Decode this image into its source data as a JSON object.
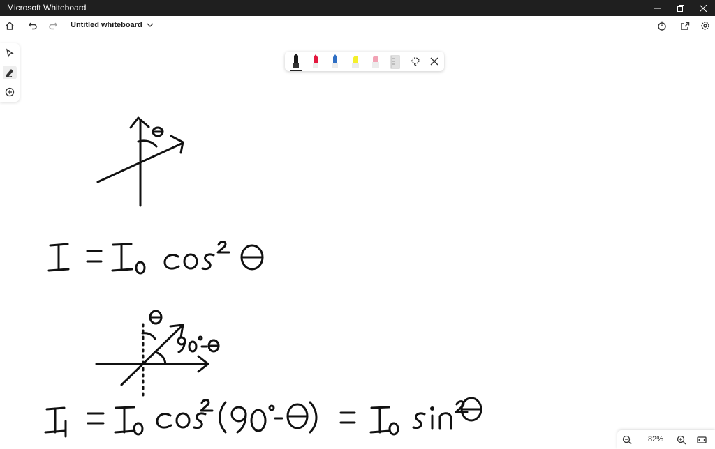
{
  "window": {
    "title": "Microsoft Whiteboard"
  },
  "toolbar": {
    "doc_title": "Untitled whiteboard",
    "icons": [
      "home-icon",
      "undo-icon",
      "redo-icon",
      "timer-icon",
      "share-icon",
      "settings-icon"
    ]
  },
  "left_rail": {
    "tools": [
      "select-icon",
      "pen-icon",
      "add-icon"
    ],
    "active_tool": "pen"
  },
  "pen_tray": {
    "pens": [
      {
        "name": "black-pen",
        "color": "#1a1a1a"
      },
      {
        "name": "red-pen",
        "color": "#e3173e"
      },
      {
        "name": "blue-pen",
        "color": "#2f6fc4"
      },
      {
        "name": "yellow-highlighter",
        "color": "#f4ef2b"
      },
      {
        "name": "pink-highlighter",
        "color": "#f2a3b5"
      },
      {
        "name": "ruler",
        "color": "#d0d0d0"
      }
    ],
    "selected": "black-pen",
    "extra_icons": [
      "lasso-icon",
      "close-icon"
    ]
  },
  "canvas": {
    "handwriting_equation_1": "I = I₀ cos² θ",
    "handwriting_equation_2": "I₁ = I₀ cos²(90°-θ) = I₀ sin²θ",
    "label_theta": "θ",
    "label_complement": "90°-θ"
  },
  "zoom": {
    "level": "82%"
  }
}
